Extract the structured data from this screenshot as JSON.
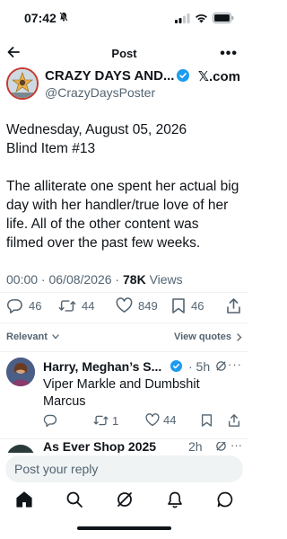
{
  "status_bar": {
    "time": "07:42"
  },
  "nav": {
    "title": "Post",
    "more": "•••"
  },
  "author": {
    "name": "CRAZY DAYS AND...",
    "handle": "@CrazyDaysPoster",
    "brand": "𝕏.com"
  },
  "post": {
    "paragraph1": [
      "Wednesday, August 05, 2026",
      "Blind Item #13"
    ],
    "paragraph2": [
      "The alliterate one spent her actual big",
      "day with her handler/true love of her",
      "life. All of the other content was",
      "filmed over the past few weeks."
    ],
    "timestamp": "00:00 · 06/08/2026 · ",
    "views_count": "78K",
    "views_label": " Views"
  },
  "actions": {
    "replies": "46",
    "reposts": "44",
    "likes": "849",
    "bookmarks": "46"
  },
  "sort": {
    "label": "Relevant",
    "view_quotes": "View quotes"
  },
  "reply": {
    "name": "Harry, Meghan’s S...",
    "time": "· 5h",
    "text": [
      "Viper Markle and Dumbshit",
      "Marcus"
    ],
    "reposts": "1",
    "likes": "44"
  },
  "next_reply": {
    "name": "As Ever Shop 2025",
    "time": "2h"
  },
  "composer": {
    "placeholder": "Post your reply"
  },
  "colors": {
    "accent": "#1d9bf0",
    "text": "#0f1419",
    "muted": "#536471"
  }
}
